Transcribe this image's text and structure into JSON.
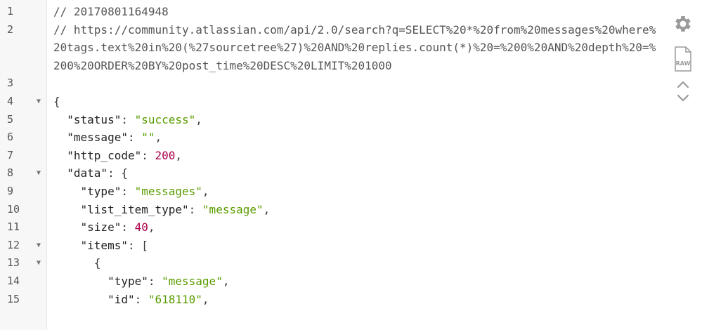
{
  "lines": [
    {
      "num": "1",
      "fold": false,
      "parts": [
        {
          "t": "cm",
          "v": "// 20170801164948"
        }
      ]
    },
    {
      "num": "2",
      "fold": false,
      "wrap": 3,
      "parts": [
        {
          "t": "cm",
          "v": "// https://community.atlassian.com/api/2.0/search?q=SELECT%20*%20from%20messages%20where%20tags.text%20in%20(%27sourcetree%27)%20AND%20replies.count(*)%20=%200%20AND%20depth%20=%200%20ORDER%20BY%20post_time%20DESC%20LIMIT%201000"
        }
      ]
    },
    {
      "num": "3",
      "fold": false,
      "parts": []
    },
    {
      "num": "4",
      "fold": true,
      "parts": [
        {
          "t": "punc",
          "v": "{"
        }
      ]
    },
    {
      "num": "5",
      "fold": false,
      "parts": [
        {
          "t": "punc",
          "v": "  "
        },
        {
          "t": "key",
          "v": "\"status\""
        },
        {
          "t": "punc",
          "v": ": "
        },
        {
          "t": "str",
          "v": "\"success\""
        },
        {
          "t": "punc",
          "v": ","
        }
      ]
    },
    {
      "num": "6",
      "fold": false,
      "parts": [
        {
          "t": "punc",
          "v": "  "
        },
        {
          "t": "key",
          "v": "\"message\""
        },
        {
          "t": "punc",
          "v": ": "
        },
        {
          "t": "str",
          "v": "\"\""
        },
        {
          "t": "punc",
          "v": ","
        }
      ]
    },
    {
      "num": "7",
      "fold": false,
      "parts": [
        {
          "t": "punc",
          "v": "  "
        },
        {
          "t": "key",
          "v": "\"http_code\""
        },
        {
          "t": "punc",
          "v": ": "
        },
        {
          "t": "num",
          "v": "200"
        },
        {
          "t": "punc",
          "v": ","
        }
      ]
    },
    {
      "num": "8",
      "fold": true,
      "parts": [
        {
          "t": "punc",
          "v": "  "
        },
        {
          "t": "key",
          "v": "\"data\""
        },
        {
          "t": "punc",
          "v": ": {"
        }
      ]
    },
    {
      "num": "9",
      "fold": false,
      "parts": [
        {
          "t": "punc",
          "v": "    "
        },
        {
          "t": "key",
          "v": "\"type\""
        },
        {
          "t": "punc",
          "v": ": "
        },
        {
          "t": "str",
          "v": "\"messages\""
        },
        {
          "t": "punc",
          "v": ","
        }
      ]
    },
    {
      "num": "10",
      "fold": false,
      "parts": [
        {
          "t": "punc",
          "v": "    "
        },
        {
          "t": "key",
          "v": "\"list_item_type\""
        },
        {
          "t": "punc",
          "v": ": "
        },
        {
          "t": "str",
          "v": "\"message\""
        },
        {
          "t": "punc",
          "v": ","
        }
      ]
    },
    {
      "num": "11",
      "fold": false,
      "parts": [
        {
          "t": "punc",
          "v": "    "
        },
        {
          "t": "key",
          "v": "\"size\""
        },
        {
          "t": "punc",
          "v": ": "
        },
        {
          "t": "num",
          "v": "40"
        },
        {
          "t": "punc",
          "v": ","
        }
      ]
    },
    {
      "num": "12",
      "fold": true,
      "parts": [
        {
          "t": "punc",
          "v": "    "
        },
        {
          "t": "key",
          "v": "\"items\""
        },
        {
          "t": "punc",
          "v": ": ["
        }
      ]
    },
    {
      "num": "13",
      "fold": true,
      "parts": [
        {
          "t": "punc",
          "v": "      {"
        }
      ]
    },
    {
      "num": "14",
      "fold": false,
      "parts": [
        {
          "t": "punc",
          "v": "        "
        },
        {
          "t": "key",
          "v": "\"type\""
        },
        {
          "t": "punc",
          "v": ": "
        },
        {
          "t": "str",
          "v": "\"message\""
        },
        {
          "t": "punc",
          "v": ","
        }
      ]
    },
    {
      "num": "15",
      "fold": false,
      "parts": [
        {
          "t": "punc",
          "v": "        "
        },
        {
          "t": "key",
          "v": "\"id\""
        },
        {
          "t": "punc",
          "v": ": "
        },
        {
          "t": "str",
          "v": "\"618110\""
        },
        {
          "t": "punc",
          "v": ","
        }
      ]
    }
  ],
  "fold_glyph": "▼",
  "toolbar": {
    "settings_icon": "gear-icon",
    "raw_icon": "raw-file-icon",
    "raw_label": "RAW",
    "up_icon": "chevron-up-icon",
    "down_icon": "chevron-down-icon"
  },
  "colors": {
    "string": "#5a9c00",
    "number": "#a8004a",
    "key": "#222222",
    "comment": "#555555",
    "gutter_bg": "#f7f7f7",
    "icon": "#9a9a9a"
  }
}
